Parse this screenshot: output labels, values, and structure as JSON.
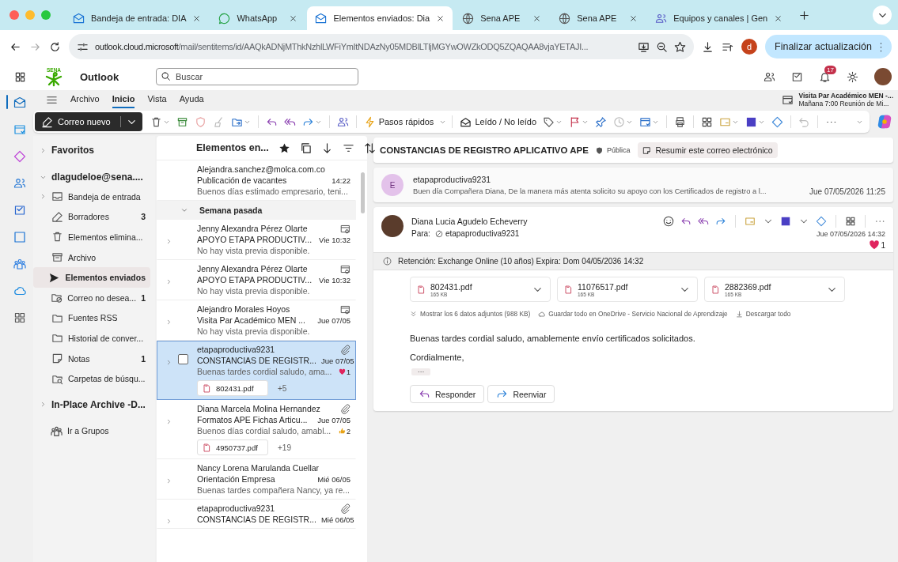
{
  "browser": {
    "tabs": [
      {
        "kind": "outlook",
        "title": "Bandeja de entrada: DIA",
        "selected": false
      },
      {
        "kind": "whatsapp",
        "title": "WhatsApp",
        "selected": false
      },
      {
        "kind": "outlook",
        "title": "Elementos enviados: Dia",
        "selected": true
      },
      {
        "kind": "web",
        "title": "Sena APE",
        "selected": false
      },
      {
        "kind": "web",
        "title": "Sena APE",
        "selected": false
      },
      {
        "kind": "teams",
        "title": "Equipos y canales | Gen",
        "selected": false
      }
    ],
    "address_host": "outlook.cloud.microsoft",
    "address_path": "/mail/sentitems/id/AAQkADNjMThkNzhlLWFiYmItNDAzNy05MDBlLTljMGYwOWZkODQ5ZQAQAA8vjaYETAJI...",
    "profile_initial": "d",
    "update_button": "Finalizar actualización"
  },
  "app": {
    "logo_text": "SENA",
    "name": "Outlook",
    "search_placeholder": "Buscar",
    "notification_count": "17",
    "reminder": {
      "title": "Visita Par Académico MEN -...",
      "detail": "Mañana 7:00 Reunión de Mi..."
    }
  },
  "ribbon": {
    "tabs": [
      {
        "label": "Archivo",
        "selected": false
      },
      {
        "label": "Inicio",
        "selected": true
      },
      {
        "label": "Vista",
        "selected": false
      },
      {
        "label": "Ayuda",
        "selected": false
      }
    ],
    "new_mail": "Correo nuevo",
    "quick_steps": "Pasos rápidos",
    "read_unread": "Leído / No leído"
  },
  "folders": {
    "favorites": "Favoritos",
    "account": "dlagudeloe@sena....",
    "items": [
      {
        "kind": "inbox",
        "label": "Bandeja de entrada",
        "expandable": true,
        "selected": false
      },
      {
        "kind": "drafts",
        "label": "Borradores",
        "count": "3",
        "selected": false
      },
      {
        "kind": "deleted",
        "label": "Elementos elimina...",
        "selected": false
      },
      {
        "kind": "archive",
        "label": "Archivo",
        "selected": false
      },
      {
        "kind": "sent",
        "label": "Elementos enviados",
        "selected": true
      },
      {
        "kind": "junk",
        "label": "Correo no desea...",
        "count": "1",
        "selected": false
      },
      {
        "kind": "folder",
        "label": "Fuentes RSS",
        "selected": false
      },
      {
        "kind": "folder",
        "label": "Historial de conver...",
        "selected": false
      },
      {
        "kind": "notes",
        "label": "Notas",
        "count": "1",
        "selected": false
      },
      {
        "kind": "search",
        "label": "Carpetas de búsqu...",
        "selected": false
      }
    ],
    "archive": "In-Place Archive -D...",
    "groups": "Ir a Grupos"
  },
  "message_list": {
    "title": "Elementos en...",
    "items": [
      {
        "kind": "message",
        "sender": "Alejandra.sanchez@molca.com.co",
        "subject": "Publicación de vacantes",
        "time": "14:22",
        "preview": "Buenos días estimado empresario, teni...",
        "expandable": false,
        "is_invite": false,
        "has_attachment": false,
        "selected": false
      },
      {
        "kind": "group",
        "label": "Semana pasada",
        "expanded": true
      },
      {
        "kind": "message",
        "sender": "Jenny Alexandra Pérez Olarte",
        "subject": "APOYO ETAPA PRODUCTIV...",
        "time": "Vie 10:32",
        "preview": "No hay vista previa disponible.",
        "expandable": true,
        "is_invite": true,
        "has_attachment": false,
        "selected": false
      },
      {
        "kind": "message",
        "sender": "Jenny Alexandra Pérez Olarte",
        "subject": "APOYO ETAPA PRODUCTIV...",
        "time": "Vie 10:32",
        "preview": "No hay vista previa disponible.",
        "expandable": true,
        "is_invite": true,
        "has_attachment": false,
        "selected": false
      },
      {
        "kind": "message",
        "sender": "Alejandro Morales Hoyos",
        "subject": "Visita Par Académico MEN ...",
        "time": "Jue 07/05",
        "preview": "No hay vista previa disponible.",
        "expandable": true,
        "is_invite": true,
        "has_attachment": false,
        "selected": false
      },
      {
        "kind": "message",
        "sender": "etapaproductiva9231",
        "subject": "CONSTANCIAS DE REGISTR...",
        "time": "Jue 07/05",
        "preview": "Buenas tardes cordial saludo, ama...",
        "expandable": true,
        "is_invite": false,
        "has_attachment": true,
        "reaction": {
          "kind": "heart",
          "count": "1"
        },
        "attachment": {
          "name": "802431.pdf",
          "more": "+5"
        },
        "selected": true
      },
      {
        "kind": "message",
        "sender": "Diana Marcela Molina Hernandez",
        "subject": "Formatos APE Fichas Articu...",
        "time": "Jue 07/05",
        "preview": "Buenos días cordial saludo, amabl...",
        "expandable": true,
        "is_invite": false,
        "has_attachment": true,
        "reaction": {
          "kind": "thumb",
          "count": "2"
        },
        "attachment": {
          "name": "4950737.pdf",
          "more": "+19"
        },
        "selected": false
      },
      {
        "kind": "message",
        "sender": "Nancy Lorena Marulanda Cuellar",
        "subject": "Orientación Empresa",
        "time": "Mié 06/05",
        "preview": "Buenas tardes compañera Nancy, ya re...",
        "expandable": true,
        "is_invite": false,
        "has_attachment": false,
        "selected": false
      },
      {
        "kind": "message",
        "sender": "etapaproductiva9231",
        "subject": "CONSTANCIAS DE REGISTR...",
        "time": "Mié 06/05",
        "expandable": true,
        "is_invite": false,
        "has_attachment": true,
        "selected": false
      }
    ]
  },
  "reading": {
    "subject": "CONSTANCIAS DE REGISTRO APLICATIVO APE",
    "sensitivity": "Pública",
    "summarize_button": "Resumir este correo electrónico",
    "collapsed_message": {
      "avatar_initial": "E",
      "sender": "etapaproductiva9231",
      "preview": "Buen día Compañera Diana, De la manera más atenta solicito su apoyo con los Certificados de registro a l...",
      "date": "Jue 07/05/2026 11:25"
    },
    "message": {
      "sender": "Diana Lucia Agudelo Echeverry",
      "to_label": "Para:",
      "recipient": "etapaproductiva9231",
      "date": "Jue 07/05/2026 14:32",
      "reaction_count": "1",
      "retention": "Retención: Exchange Online (10 años) Expira: Dom 04/05/2036 14:32",
      "attachments": [
        {
          "name": "802431.pdf",
          "size": "165 KB"
        },
        {
          "name": "11076517.pdf",
          "size": "165 KB"
        },
        {
          "name": "2882369.pdf",
          "size": "165 KB"
        }
      ],
      "show_all": "Mostrar los 6 datos adjuntos (988 KB)",
      "save_onedrive": "Guardar todo en OneDrive - Servicio Nacional de Aprendizaje",
      "download_all": "Descargar todo",
      "body": [
        "Buenas tardes cordial saludo, amablemente envío certificados solicitados.",
        "Cordialmente,"
      ],
      "reply": "Responder",
      "forward": "Reenviar"
    }
  }
}
